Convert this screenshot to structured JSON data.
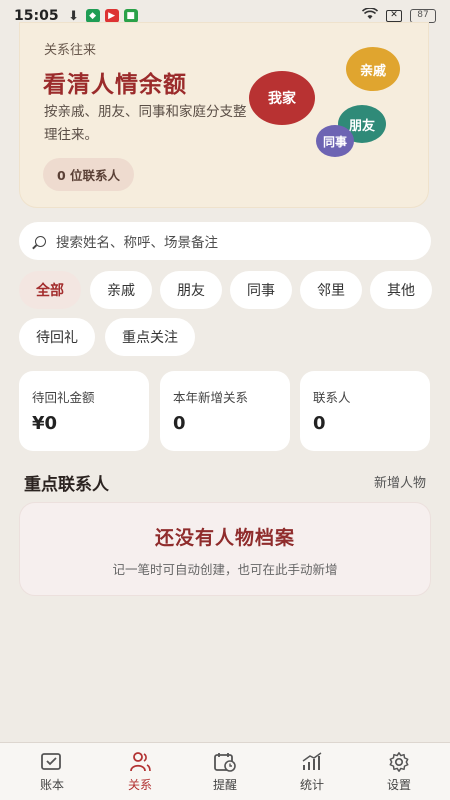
{
  "status_bar": {
    "time": "15:05",
    "battery": "87"
  },
  "hero": {
    "kicker": "关系往来",
    "title": "看清人情余额",
    "description": "按亲戚、朋友、同事和家庭分支整理往来。",
    "contacts_pill": "0 位联系人",
    "bubbles": {
      "me": "我家",
      "family": "亲戚",
      "friend": "朋友",
      "colleague": "同事"
    }
  },
  "search": {
    "placeholder": "搜索姓名、称呼、场景备注"
  },
  "filters": {
    "all": "全部",
    "relatives": "亲戚",
    "friends": "朋友",
    "colleagues": "同事",
    "neighbors": "邻里",
    "others": "其他",
    "pending_return": "待回礼",
    "focus": "重点关注"
  },
  "stats": {
    "pending_amount_label": "待回礼金额",
    "pending_amount_value": "¥0",
    "new_relations_label": "本年新增关系",
    "new_relations_value": "0",
    "contacts_label": "联系人",
    "contacts_value": "0"
  },
  "key_contacts": {
    "title": "重点联系人",
    "add_label": "新增人物",
    "empty_title": "还没有人物档案",
    "empty_subtitle": "记一笔时可自动创建，也可在此手动新增"
  },
  "tabbar": {
    "ledger": "账本",
    "relations": "关系",
    "reminders": "提醒",
    "statistics": "统计",
    "settings": "设置"
  },
  "colors": {
    "accent": "#b23232",
    "background": "#efebe5",
    "hero_bg": "#f6eddd"
  }
}
